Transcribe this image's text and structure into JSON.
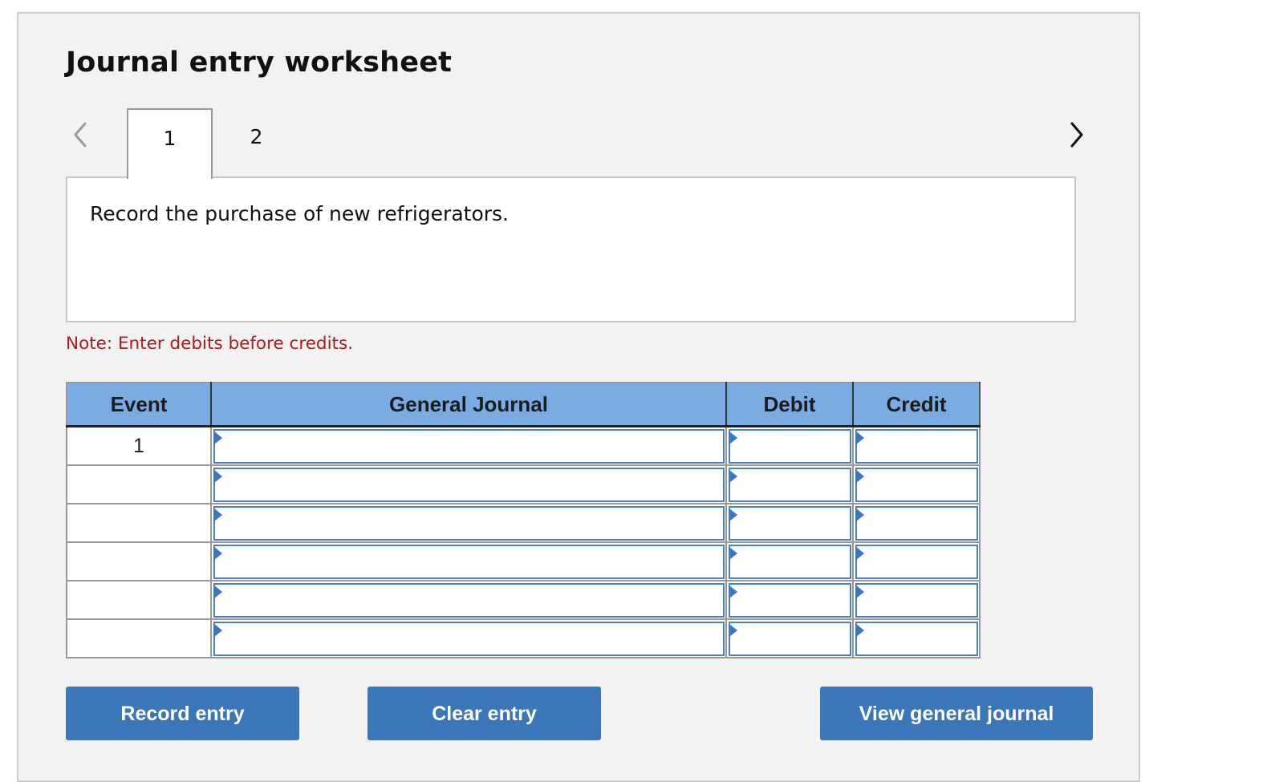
{
  "worksheet": {
    "title": "Journal entry worksheet",
    "nav": {
      "prev_icon": "chevron-left-icon",
      "next_icon": "chevron-right-icon"
    },
    "tabs": [
      {
        "label": "1",
        "active": true
      },
      {
        "label": "2",
        "active": false
      }
    ],
    "instruction": "Record the purchase of new refrigerators.",
    "note": "Note: Enter debits before credits.",
    "colors": {
      "header_bg": "#7aabe2",
      "button_bg": "#3b76b8",
      "note_text": "#b0191e",
      "input_border": "#4a7fc1"
    }
  },
  "table": {
    "headers": [
      "Event",
      "General Journal",
      "Debit",
      "Credit"
    ],
    "rows": [
      {
        "event": "1",
        "journal": "",
        "debit": "",
        "credit": ""
      },
      {
        "event": "",
        "journal": "",
        "debit": "",
        "credit": ""
      },
      {
        "event": "",
        "journal": "",
        "debit": "",
        "credit": ""
      },
      {
        "event": "",
        "journal": "",
        "debit": "",
        "credit": ""
      },
      {
        "event": "",
        "journal": "",
        "debit": "",
        "credit": ""
      },
      {
        "event": "",
        "journal": "",
        "debit": "",
        "credit": ""
      }
    ]
  },
  "buttons": {
    "record": "Record entry",
    "clear": "Clear entry",
    "view": "View general journal"
  }
}
